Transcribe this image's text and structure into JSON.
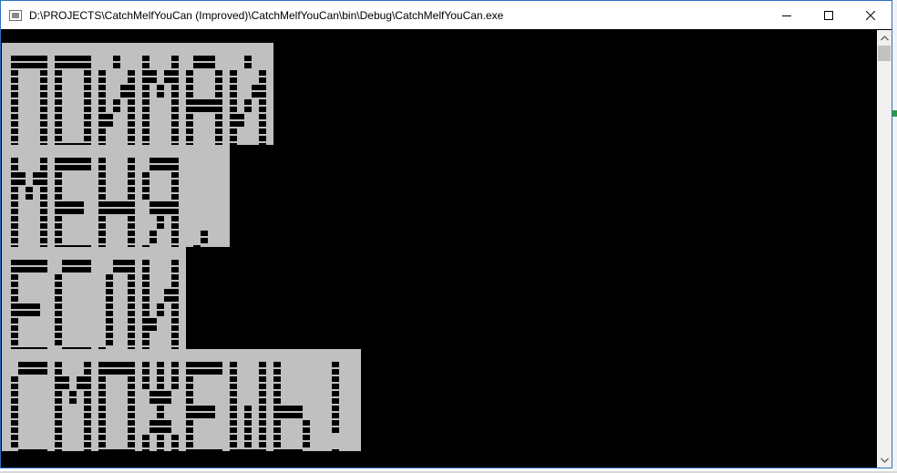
{
  "window": {
    "title": "D:\\PROJECTS\\CatchMelfYouCan (Improved)\\CatchMelfYouCan\\bin\\Debug\\CatchMelfYouCan.exe",
    "icon": "console-window-icon",
    "controls": [
      "minimize-icon",
      "maximize-icon",
      "close-icon"
    ]
  },
  "console": {
    "banner_lines": [
      "ПОЙМАЙ",
      "МЕНЯ,",
      "ЕСЛИ",
      "СМОЖЕШЬ!"
    ],
    "banner_text_color": "#000000",
    "banner_background_color": "#c0c0c0",
    "console_background_color": "#000000"
  },
  "scrollbar": {
    "up_icon": "chevron-up-icon",
    "down_icon": "chevron-down-icon"
  }
}
